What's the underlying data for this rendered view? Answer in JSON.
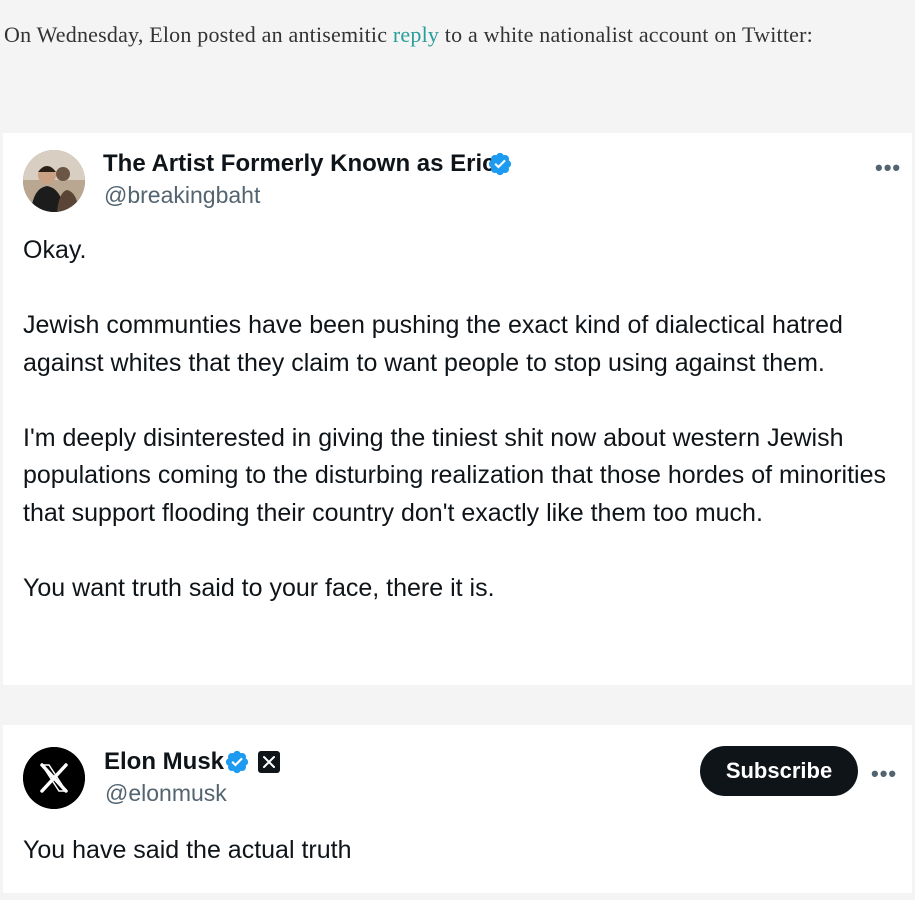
{
  "article": {
    "intro_before": "On Wednesday, Elon posted an antisemitic ",
    "intro_link": "reply",
    "intro_after": " to a white nationalist account on Twitter:"
  },
  "tweets": [
    {
      "display_name": "The Artist Formerly Known as Eric",
      "handle": "@breakingbaht",
      "verified": true,
      "more_label": "•••",
      "text": "Okay.\n\nJewish communties have been pushing the exact kind of dialectical hatred against whites that they claim to want people to stop using against them.\n\nI'm deeply disinterested in giving the tiniest shit now about western Jewish populations coming to the disturbing realization that those hordes of minorities that support flooding their country don't exactly like them too much.\n\nYou want truth said to your face, there it is."
    },
    {
      "display_name": "Elon Musk",
      "handle": "@elonmusk",
      "verified": true,
      "subscribe_label": "Subscribe",
      "more_label": "•••",
      "text": "You have said the actual truth"
    }
  ],
  "colors": {
    "verified_blue": "#1d9bf0",
    "link_teal": "#2a9d9b",
    "subscribe_bg": "#0f1419"
  }
}
